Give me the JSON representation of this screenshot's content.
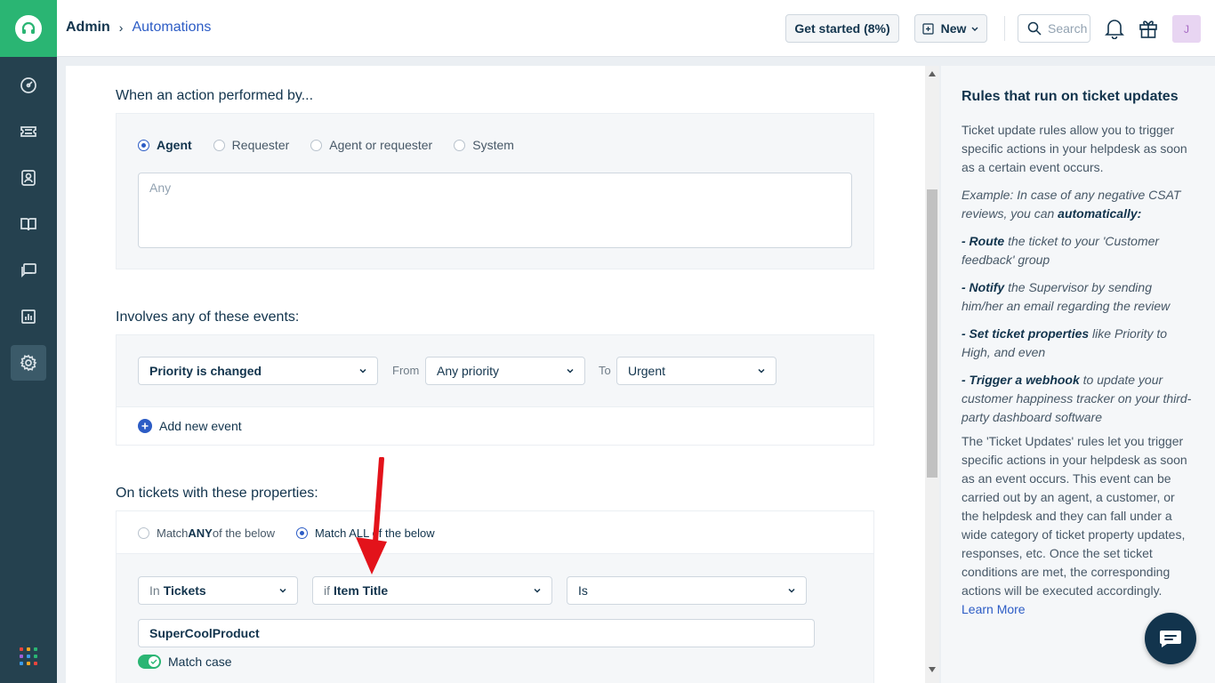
{
  "header": {
    "breadcrumb_root": "Admin",
    "breadcrumb_current": "Automations",
    "get_started_label": "Get started (8%)",
    "new_label": "New",
    "search_placeholder": "Search",
    "avatar_initial": "J"
  },
  "sidebar": {
    "items": [
      {
        "name": "dashboard-icon"
      },
      {
        "name": "tickets-icon"
      },
      {
        "name": "contacts-icon"
      },
      {
        "name": "solutions-icon"
      },
      {
        "name": "forums-icon"
      },
      {
        "name": "reports-icon"
      },
      {
        "name": "admin-gear-icon",
        "active": true
      }
    ]
  },
  "performed_by": {
    "title": "When an action performed by...",
    "options": [
      "Agent",
      "Requester",
      "Agent or requester",
      "System"
    ],
    "selected": "Agent",
    "placeholder": "Any"
  },
  "events": {
    "title": "Involves any of these events:",
    "event_value": "Priority is changed",
    "from_label": "From",
    "from_value": "Any priority",
    "to_label": "To",
    "to_value": "Urgent",
    "add_label": "Add new event"
  },
  "properties": {
    "title": "On tickets with these properties:",
    "match_any_pre": "Match ",
    "match_any_bold": "ANY",
    "match_any_post": " of the below",
    "match_all_label": "Match ALL of the below",
    "in_prefix": "In",
    "in_value": "Tickets",
    "if_prefix": "if",
    "if_value": "Item Title",
    "operator_value": "Is",
    "value_input": "SuperCoolProduct",
    "match_case_label": "Match case"
  },
  "side_panel": {
    "title": "Rules that run on ticket updates",
    "intro": "Ticket update rules allow you to trigger specific actions in your helpdesk as soon as a certain event occurs.",
    "example_pre": "Example: In case of any negative CSAT reviews, you can ",
    "example_bold": "automatically:",
    "bullet1_bold": "- Route",
    "bullet1_rest": " the ticket to your 'Customer feedback' group",
    "bullet2_bold": "- Notify",
    "bullet2_rest": " the Supervisor by sending him/her an email regarding the review",
    "bullet3_bold": "- Set ticket properties",
    "bullet3_rest": " like Priority to High, and even",
    "bullet4_bold": "- Trigger a webhook",
    "bullet4_rest": " to update your customer happiness tracker on your third-party dashboard software",
    "body": "The 'Ticket Updates' rules let you trigger specific actions in your helpdesk as soon as an event occurs. This event can be carried out by an agent, a customer, or the helpdesk and they can fall under a wide category of ticket property updates, responses, etc. Once the set ticket conditions are met, the corresponding actions will be executed accordingly.",
    "learn_more": "Learn More"
  },
  "colors": {
    "accent": "#2c5cc5",
    "brand_green": "#2ab573",
    "sidebar_bg": "#25414f",
    "annotation_arrow": "#e3131b"
  }
}
